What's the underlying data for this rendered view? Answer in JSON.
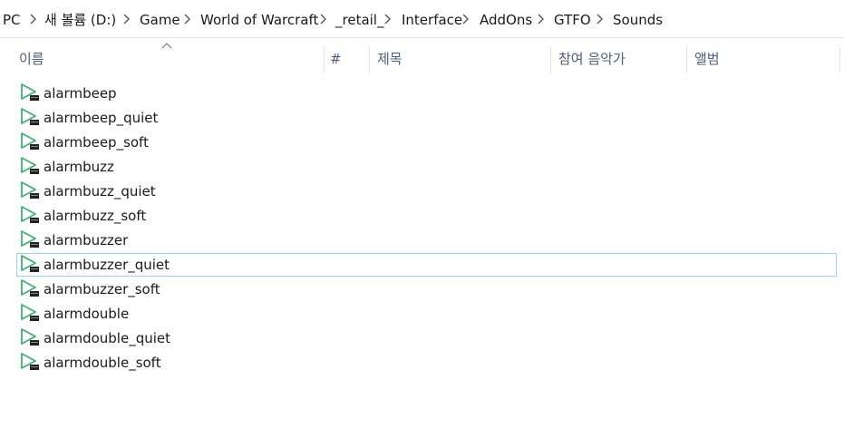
{
  "breadcrumb": {
    "items": [
      "PC",
      "새 볼륨 (D:)",
      "Game",
      "World of Warcraft",
      "_retail_",
      "Interface",
      "AddOns",
      "GTFO",
      "Sounds"
    ]
  },
  "columns": {
    "name": "이름",
    "number": "#",
    "title": "제목",
    "artists": "참여 음악가",
    "album": "앨범"
  },
  "files": [
    "alarmbeep",
    "alarmbeep_quiet",
    "alarmbeep_soft",
    "alarmbuzz",
    "alarmbuzz_quiet",
    "alarmbuzz_soft",
    "alarmbuzzer",
    "alarmbuzzer_quiet",
    "alarmbuzzer_soft",
    "alarmdouble",
    "alarmdouble_quiet",
    "alarmdouble_soft"
  ],
  "selected_file": "alarmbuzzer_quiet",
  "icons": {
    "chevron": "chevron-right-icon",
    "sort": "sort-ascending-icon",
    "file": "audio-file-icon"
  },
  "colors": {
    "icon_green": "#3cb371",
    "selection_border": "#99d1ff",
    "header_text": "#4c607a"
  }
}
